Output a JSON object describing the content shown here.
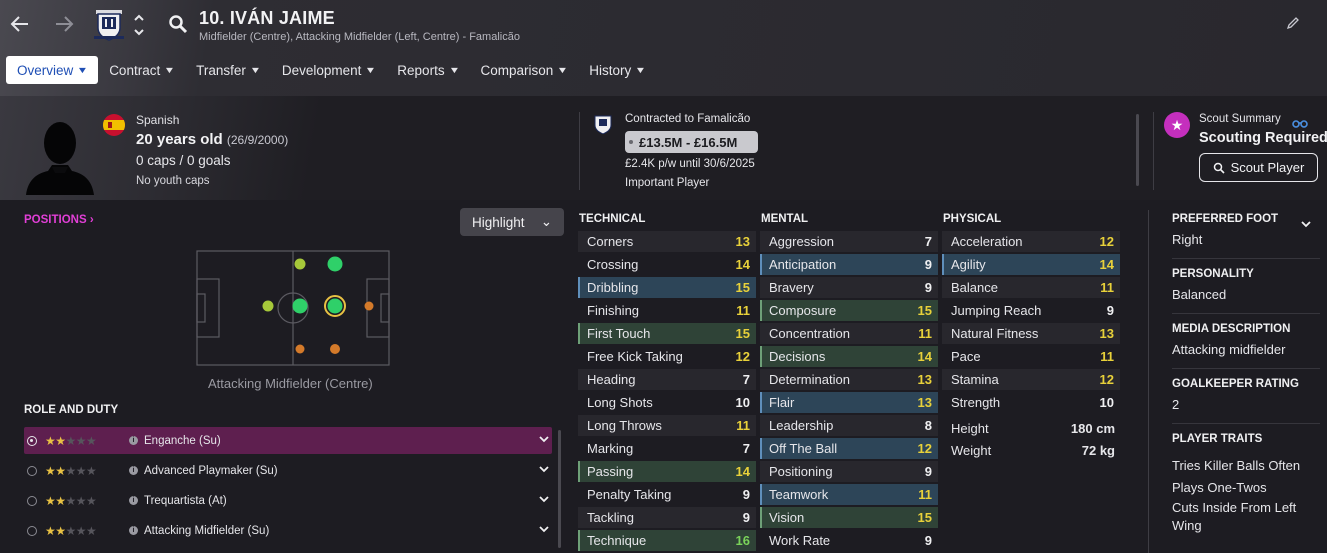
{
  "player": {
    "name": "10. IVÁN JAIME",
    "subtitle": "Midfielder (Centre), Attacking Midfielder (Left, Centre) - Famalicão",
    "nationality": "Spanish",
    "age": "20 years old",
    "dob": "(26/9/2000)",
    "caps": "0 caps / 0 goals",
    "youth_caps": "No youth caps"
  },
  "tabs": [
    {
      "label": "Overview"
    },
    {
      "label": "Contract"
    },
    {
      "label": "Transfer"
    },
    {
      "label": "Development"
    },
    {
      "label": "Reports"
    },
    {
      "label": "Comparison"
    },
    {
      "label": "History"
    }
  ],
  "contract": {
    "club_line": "Contracted to Famalicão",
    "value": "£13.5M - £16.5M",
    "wage": "£2.4K p/w until 30/6/2025",
    "status": "Important Player"
  },
  "scout": {
    "title": "Scout Summary",
    "status": "Scouting Required",
    "button": "Scout Player"
  },
  "positions": {
    "label": "POSITIONS",
    "highlight": "Highlight",
    "caption": "Attacking Midfielder (Centre)"
  },
  "role_duty": {
    "label": "ROLE AND DUTY",
    "roles": [
      {
        "name": "Enganche (Su)",
        "stars": 2,
        "selected": true
      },
      {
        "name": "Advanced Playmaker (Su)",
        "stars": 2,
        "selected": false
      },
      {
        "name": "Trequartista (At)",
        "stars": 2,
        "selected": false
      },
      {
        "name": "Attacking Midfielder (Su)",
        "stars": 2,
        "selected": false
      }
    ]
  },
  "attributes": {
    "technical_label": "TECHNICAL",
    "mental_label": "MENTAL",
    "physical_label": "PHYSICAL",
    "technical": [
      {
        "name": "Corners",
        "value": "13",
        "hl": ""
      },
      {
        "name": "Crossing",
        "value": "14",
        "hl": ""
      },
      {
        "name": "Dribbling",
        "value": "15",
        "hl": "blue"
      },
      {
        "name": "Finishing",
        "value": "11",
        "hl": ""
      },
      {
        "name": "First Touch",
        "value": "15",
        "hl": "green"
      },
      {
        "name": "Free Kick Taking",
        "value": "12",
        "hl": ""
      },
      {
        "name": "Heading",
        "value": "7",
        "hl": ""
      },
      {
        "name": "Long Shots",
        "value": "10",
        "hl": ""
      },
      {
        "name": "Long Throws",
        "value": "11",
        "hl": ""
      },
      {
        "name": "Marking",
        "value": "7",
        "hl": ""
      },
      {
        "name": "Passing",
        "value": "14",
        "hl": "green"
      },
      {
        "name": "Penalty Taking",
        "value": "9",
        "hl": ""
      },
      {
        "name": "Tackling",
        "value": "9",
        "hl": ""
      },
      {
        "name": "Technique",
        "value": "16",
        "hl": "green"
      }
    ],
    "mental": [
      {
        "name": "Aggression",
        "value": "7",
        "hl": ""
      },
      {
        "name": "Anticipation",
        "value": "9",
        "hl": "blue"
      },
      {
        "name": "Bravery",
        "value": "9",
        "hl": ""
      },
      {
        "name": "Composure",
        "value": "15",
        "hl": "green"
      },
      {
        "name": "Concentration",
        "value": "11",
        "hl": ""
      },
      {
        "name": "Decisions",
        "value": "14",
        "hl": "green"
      },
      {
        "name": "Determination",
        "value": "13",
        "hl": ""
      },
      {
        "name": "Flair",
        "value": "13",
        "hl": "blue"
      },
      {
        "name": "Leadership",
        "value": "8",
        "hl": ""
      },
      {
        "name": "Off The Ball",
        "value": "12",
        "hl": "blue"
      },
      {
        "name": "Positioning",
        "value": "9",
        "hl": ""
      },
      {
        "name": "Teamwork",
        "value": "11",
        "hl": "blue"
      },
      {
        "name": "Vision",
        "value": "15",
        "hl": "green"
      },
      {
        "name": "Work Rate",
        "value": "9",
        "hl": ""
      }
    ],
    "physical": [
      {
        "name": "Acceleration",
        "value": "12",
        "hl": ""
      },
      {
        "name": "Agility",
        "value": "14",
        "hl": "blue"
      },
      {
        "name": "Balance",
        "value": "11",
        "hl": ""
      },
      {
        "name": "Jumping Reach",
        "value": "9",
        "hl": ""
      },
      {
        "name": "Natural Fitness",
        "value": "13",
        "hl": ""
      },
      {
        "name": "Pace",
        "value": "11",
        "hl": ""
      },
      {
        "name": "Stamina",
        "value": "12",
        "hl": ""
      },
      {
        "name": "Strength",
        "value": "10",
        "hl": ""
      }
    ],
    "height_label": "Height",
    "height": "180 cm",
    "weight_label": "Weight",
    "weight": "72 kg"
  },
  "sidebar": {
    "foot_label": "PREFERRED FOOT",
    "foot": "Right",
    "personality_label": "PERSONALITY",
    "personality": "Balanced",
    "media_label": "MEDIA DESCRIPTION",
    "media": "Attacking midfielder",
    "gk_label": "GOALKEEPER RATING",
    "gk": "2",
    "traits_label": "PLAYER TRAITS",
    "traits": [
      "Tries Killer Balls Often",
      "Plays One-Twos",
      "Cuts Inside From Left Wing"
    ]
  },
  "colors": {
    "accent_pink": "#e13fd6",
    "value_green": "#7ad35a",
    "value_yellow": "#e8d13a",
    "highlight_blue": "#2d4558",
    "highlight_green": "#2f4337",
    "role_selected": "#5e1f4f"
  }
}
